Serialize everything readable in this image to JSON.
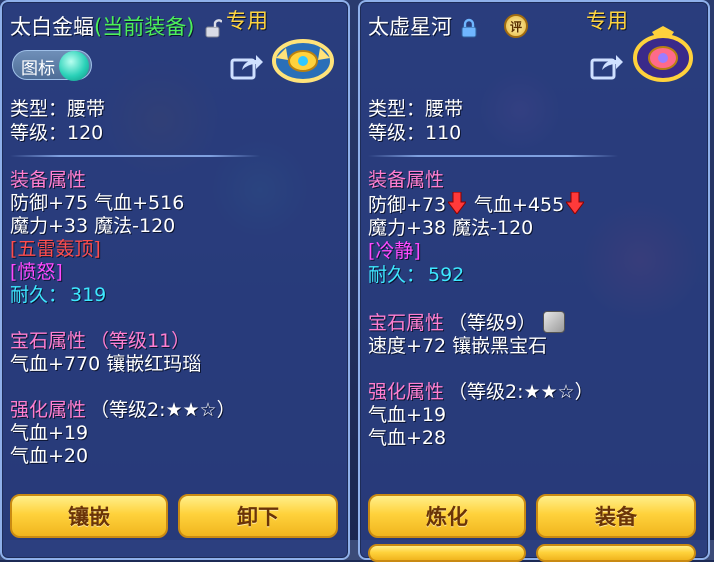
{
  "left": {
    "name": "太白金蝠",
    "status": "(当前装备)",
    "exclusive": "专用",
    "icon_toggle_label": "图标",
    "type": "类型：腰带",
    "level": "等级：120",
    "equip_header": "装备属性",
    "stat1": "防御+75 气血+516",
    "stat2": "魔力+33 魔法-120",
    "special1": "[五雷轰顶]",
    "special2": "[愤怒]",
    "durability_label": "耐久：",
    "durability_value": "319",
    "gem_header": "宝石属性",
    "gem_level": "（等级11）",
    "gem_stat": "气血+770 镶嵌红玛瑙",
    "forge_header": "强化属性",
    "forge_level": "（等级2:★★☆）",
    "forge_stat1": "气血+19",
    "forge_stat2": "气血+20",
    "btn_inlay": "镶嵌",
    "btn_unequip": "卸下"
  },
  "right": {
    "name": "太虚星河",
    "exclusive": "专用",
    "rate_badge": "评",
    "type": "类型：腰带",
    "level": "等级：110",
    "equip_header": "装备属性",
    "stat1a": "防御+73",
    "stat1b": "气血+455",
    "stat2": "魔力+38 魔法-120",
    "special1": "[冷静]",
    "durability_label": "耐久：",
    "durability_value": "592",
    "gem_header": "宝石属性",
    "gem_level": "（等级9）",
    "gem_stat": "速度+72 镶嵌黑宝石",
    "forge_header": "强化属性",
    "forge_level": "（等级2:★★☆）",
    "forge_stat1": "气血+19",
    "forge_stat2": "气血+28",
    "btn_refine": "炼化",
    "btn_equip": "装备"
  },
  "colors": {
    "attribute_header": "#ff7fd0",
    "cyan_value": "#3ee8ff",
    "special_red": "#ff4d4d",
    "special_pink": "#ff4aff",
    "exclusive_gold": "#ffd440",
    "current_equip_green": "#4cf05a"
  }
}
